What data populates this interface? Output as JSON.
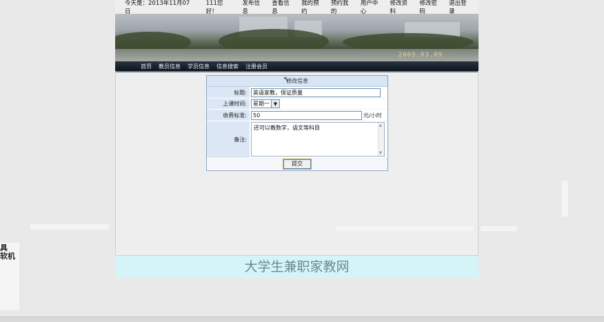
{
  "topbar": {
    "date": "今天是：2013年11月07日",
    "greeting": "111您好！",
    "links": [
      "发布信息",
      "查看信息",
      "我的预约",
      "预约我的",
      "用户中心",
      "修改资料",
      "修改密码",
      "退出登录"
    ]
  },
  "banner": {
    "stamp": "2009.03.09"
  },
  "nav": [
    "首页",
    "教员信息",
    "学员信息",
    "信息搜索",
    "注册会员"
  ],
  "form": {
    "title": "修改信息",
    "fields": {
      "title_label": "标题:",
      "title_value": "英语家教，保证质量",
      "time_label": "上课时间:",
      "time_value": "星期一",
      "fee_label": "收费标准:",
      "fee_value": "50",
      "fee_unit": "元/小时",
      "note_label": "备注:",
      "note_value": "还可以教数学，语文等科目"
    },
    "submit_label": "提交"
  },
  "footer": {
    "text": "大学生兼职家教网"
  },
  "left_tab": {
    "text": "具\n软机"
  },
  "colors": {
    "form_label_bg": "#dce7f5",
    "footer_bg": "#d4f4f7",
    "nav_bg": "#0c141c"
  }
}
